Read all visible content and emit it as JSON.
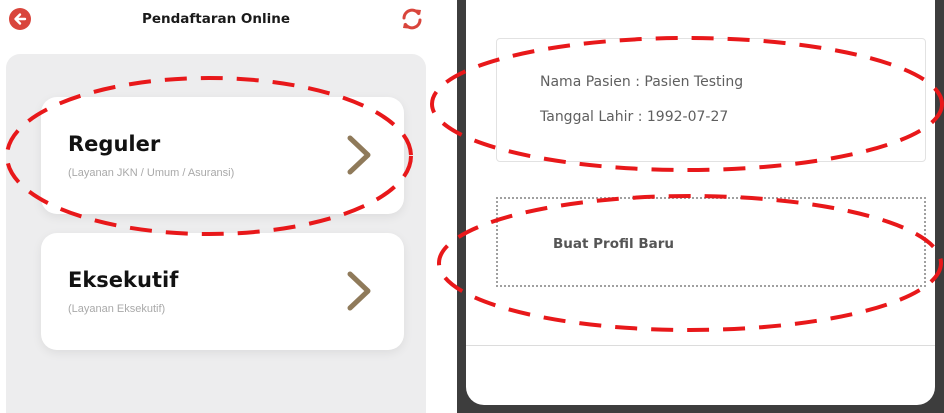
{
  "header": {
    "title": "Pendaftaran Online",
    "back_icon": "back-arrow-icon",
    "refresh_icon": "refresh-icon"
  },
  "menu": {
    "items": [
      {
        "title": "Reguler",
        "subtitle": "(Layanan JKN / Umum / Asuransi)",
        "icon": "chevron-right-icon"
      },
      {
        "title": "Eksekutif",
        "subtitle": "(Layanan Eksekutif)",
        "icon": "chevron-right-icon"
      }
    ]
  },
  "patient": {
    "name_line": "Nama Pasien : Pasien Testing",
    "dob_line": "Tanggal Lahir : 1992-07-27"
  },
  "new_profile": {
    "label": "Buat Profil Baru"
  },
  "colors": {
    "accent_red": "#d9453c",
    "chevron": "#8f7a5a",
    "highlight_dash": "#e8181a"
  }
}
